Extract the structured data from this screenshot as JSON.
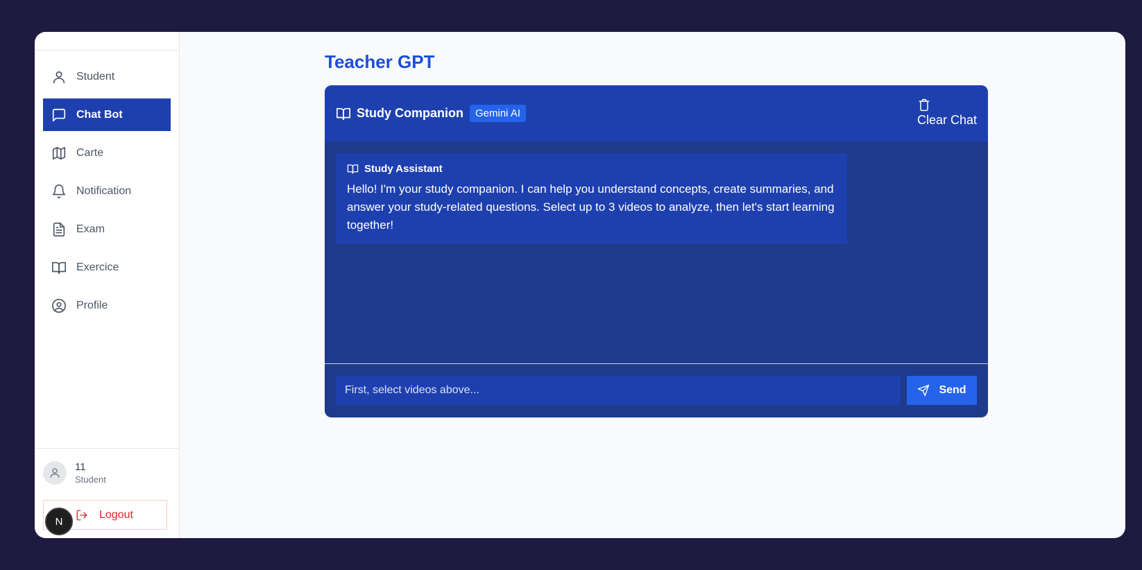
{
  "sidebar": {
    "items": [
      {
        "label": "Student",
        "icon": "user-icon",
        "active": false
      },
      {
        "label": "Chat Bot",
        "icon": "message-square-icon",
        "active": true
      },
      {
        "label": "Carte",
        "icon": "map-icon",
        "active": false
      },
      {
        "label": "Notification",
        "icon": "bell-icon",
        "active": false
      },
      {
        "label": "Exam",
        "icon": "file-text-icon",
        "active": false
      },
      {
        "label": "Exercice",
        "icon": "book-open-icon",
        "active": false
      },
      {
        "label": "Profile",
        "icon": "user-circle-icon",
        "active": false
      }
    ],
    "user": {
      "name": "11",
      "role": "Student"
    },
    "logout_label": "Logout",
    "next_badge": "N"
  },
  "main": {
    "title": "Teacher GPT",
    "chat": {
      "title": "Study Companion",
      "badge": "Gemini AI",
      "clear_label": "Clear Chat",
      "messages": [
        {
          "sender": "Study Assistant",
          "text": "Hello! I'm your study companion. I can help you understand concepts, create summaries, and answer your study-related questions. Select up to 3 videos to analyze, then let's start learning together!"
        }
      ],
      "input_placeholder": "First, select videos above...",
      "send_label": "Send"
    }
  },
  "colors": {
    "background": "#1f1a3f",
    "accent": "#1e40af",
    "chat_body": "#1e3a8a",
    "send": "#2563eb",
    "title": "#1d4ed8",
    "danger": "#dc2626"
  }
}
